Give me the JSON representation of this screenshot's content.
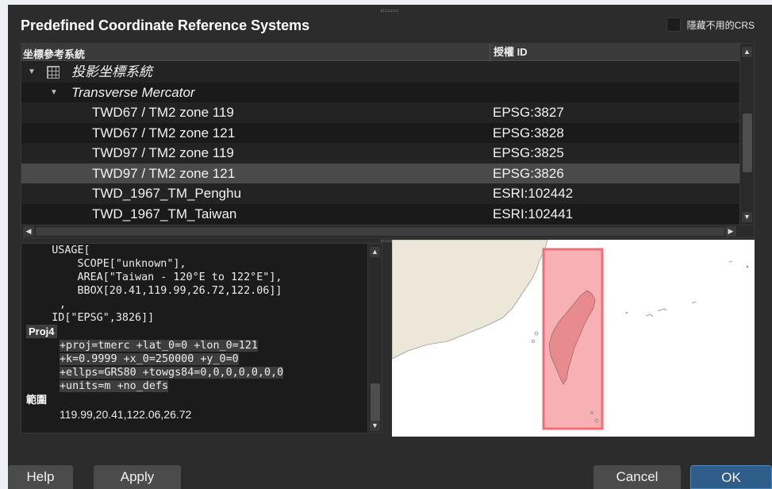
{
  "dialog": {
    "title": "Predefined Coordinate Reference Systems",
    "hide_unused_label": "隱藏不用的CRS"
  },
  "tree": {
    "columns": [
      "坐標參考系統",
      "授權 ID"
    ],
    "group": "投影坐標系統",
    "subgroup": "Transverse Mercator",
    "rows": [
      {
        "name": "TWD67 / TM2 zone 119",
        "auth": "EPSG:3827"
      },
      {
        "name": "TWD67 / TM2 zone 121",
        "auth": "EPSG:3828"
      },
      {
        "name": "TWD97 / TM2 zone 119",
        "auth": "EPSG:3825"
      },
      {
        "name": "TWD97 / TM2 zone 121",
        "auth": "EPSG:3826"
      },
      {
        "name": "TWD_1967_TM_Penghu",
        "auth": "ESRI:102442"
      },
      {
        "name": "TWD_1967_TM_Taiwan",
        "auth": "ESRI:102441"
      }
    ],
    "selected_index": 3
  },
  "wkt": {
    "lines": [
      "    USAGE[",
      "        SCOPE[\"unknown\"],",
      "        AREA[\"Taiwan - 120°E to 122°E\"],",
      "        BBOX[20.41,119.99,26.72,122.06]]",
      ",",
      "    ID[\"EPSG\",3826]]"
    ],
    "proj4_label": "Proj4",
    "proj4_lines": [
      "+proj=tmerc +lat_0=0 +lon_0=121",
      "+k=0.9999 +x_0=250000 +y_0=0",
      "+ellps=GRS80 +towgs84=0,0,0,0,0,0,0",
      "+units=m +no_defs"
    ],
    "extent_label": "範圍",
    "extent_value": "119.99,20.41,122.06,26.72"
  },
  "buttons": {
    "help": "Help",
    "apply": "Apply",
    "cancel": "Cancel",
    "ok": "OK"
  },
  "colors": {
    "extent_fill": "#f6a3a8",
    "extent_stroke": "#ee6f77",
    "land": "#ede7da",
    "selection": "#4a4a4a",
    "ok_button": "#2f5d8a"
  }
}
